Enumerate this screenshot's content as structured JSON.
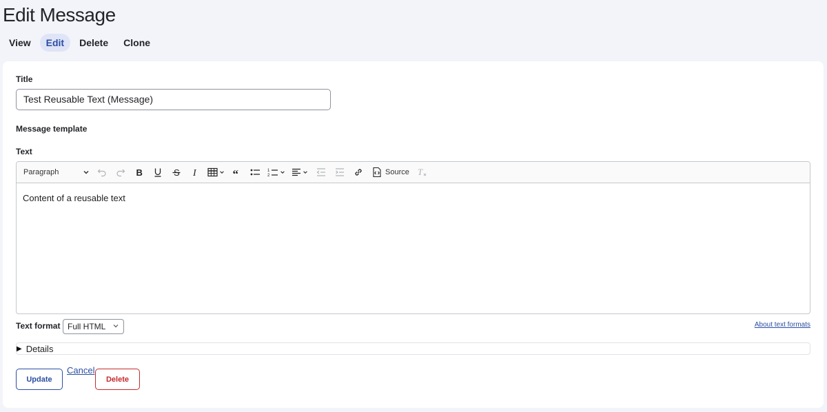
{
  "page": {
    "title": "Edit Message"
  },
  "tabs": [
    {
      "label": "View",
      "active": false
    },
    {
      "label": "Edit",
      "active": true
    },
    {
      "label": "Delete",
      "active": false
    },
    {
      "label": "Clone",
      "active": false
    }
  ],
  "form": {
    "title_label": "Title",
    "title_value": "Test Reusable Text (Message)",
    "message_template_label": "Message template",
    "text_label": "Text",
    "editor": {
      "paragraph_style": "Paragraph",
      "source_label": "Source",
      "content": "Content of a reusable text"
    },
    "text_format_label": "Text format",
    "text_format_value": "Full HTML",
    "about_formats_link": "About text formats",
    "details_label": "Details"
  },
  "actions": {
    "update_label": "Update",
    "cancel_label": "Cancel",
    "delete_label": "Delete"
  },
  "colors": {
    "accent": "#2b4ea2",
    "danger": "#c52b2b",
    "page_bg": "#f3f4f9",
    "active_tab_bg": "#dfe4f7"
  },
  "icons": [
    "chevron-down-icon",
    "undo-icon",
    "redo-icon",
    "bold-icon",
    "underline-icon",
    "strikethrough-icon",
    "italic-icon",
    "table-icon",
    "blockquote-icon",
    "bulleted-list-icon",
    "numbered-list-icon",
    "align-icon",
    "outdent-icon",
    "indent-icon",
    "link-icon",
    "source-icon",
    "remove-format-icon",
    "triangle-right-icon"
  ]
}
